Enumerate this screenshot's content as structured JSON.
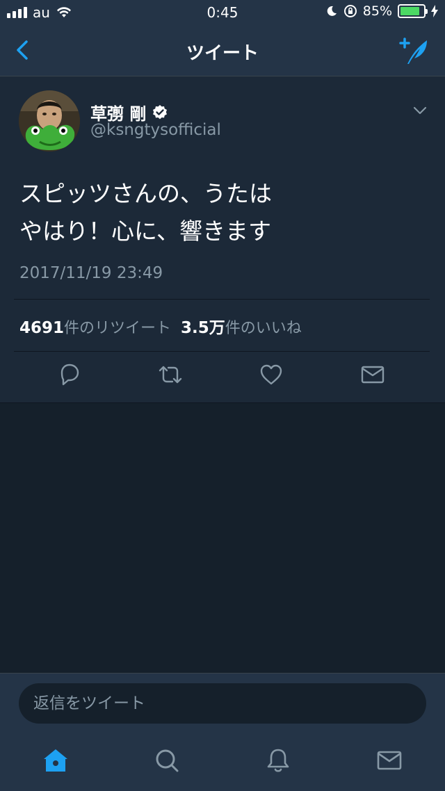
{
  "status_bar": {
    "carrier": "au",
    "time": "0:45",
    "battery_percent": "85%",
    "battery_level": 0.85,
    "battery_color": "#4cd964"
  },
  "nav": {
    "title": "ツイート",
    "back_icon": "chevron-left-icon",
    "compose_icon": "compose-tweet-icon",
    "accent_color": "#1da1f2"
  },
  "tweet": {
    "display_name": "草彅 剛",
    "handle": "@ksngtysofficial",
    "verified": true,
    "text_line1": "スピッツさんの、うたは",
    "text_line2": "やはり！心に、響きます",
    "timestamp": "2017/11/19 23:49",
    "retweet_count": "4691",
    "retweet_label": "件のリツイート",
    "like_count": "3.5万",
    "like_label": "件のいいね",
    "actions": [
      "reply-icon",
      "retweet-icon",
      "like-icon",
      "direct-message-icon"
    ]
  },
  "reply": {
    "placeholder": "返信をツイート"
  },
  "tab_bar": {
    "tabs": [
      "home-icon",
      "search-icon",
      "notifications-icon",
      "messages-icon"
    ],
    "active": "home-icon"
  }
}
